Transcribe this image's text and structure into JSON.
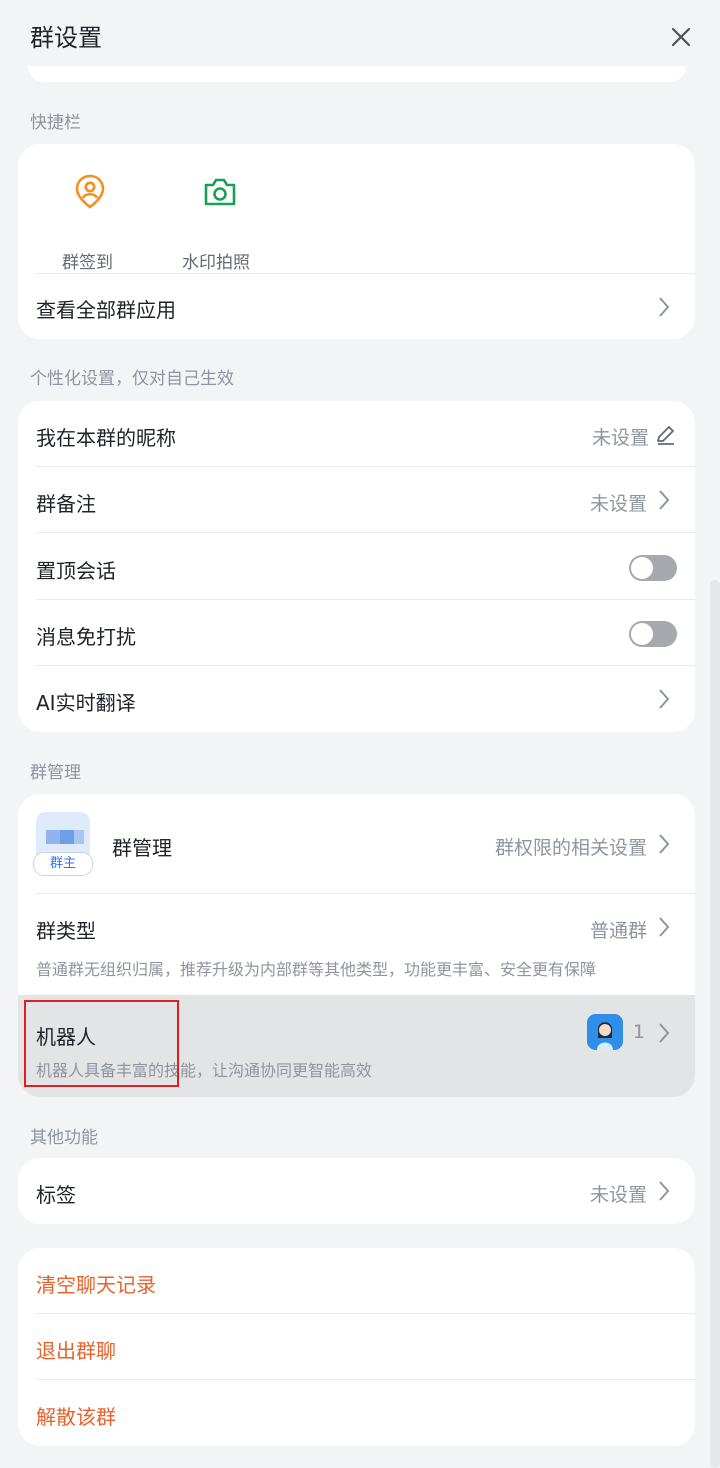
{
  "header": {
    "title": "群设置",
    "close_icon": "close-icon"
  },
  "quick_bar": {
    "section_label": "快捷栏",
    "items": [
      {
        "label": "群签到",
        "icon": "location-person-icon",
        "color": "#f5901e"
      },
      {
        "label": "水印拍照",
        "icon": "camera-icon",
        "color": "#1aa056"
      }
    ],
    "view_all_label": "查看全部群应用"
  },
  "personal": {
    "section_label": "个性化设置，仅对自己生效",
    "nickname": {
      "label": "我在本群的昵称",
      "value": "未设置"
    },
    "remark": {
      "label": "群备注",
      "value": "未设置"
    },
    "pin": {
      "label": "置顶会话",
      "on": false
    },
    "mute": {
      "label": "消息免打扰",
      "on": false
    },
    "translate": {
      "label": "AI实时翻译"
    }
  },
  "management": {
    "section_label": "群管理",
    "manage": {
      "label": "群管理",
      "badge": "群主",
      "value": "群权限的相关设置"
    },
    "group_type": {
      "label": "群类型",
      "value": "普通群",
      "description": "普通群无组织归属，推荐升级为内部群等其他类型，功能更丰富、安全更有保障"
    },
    "robot": {
      "label": "机器人",
      "count": "1",
      "description": "机器人具备丰富的技能，让沟通协同更智能高效"
    }
  },
  "other": {
    "section_label": "其他功能",
    "tags": {
      "label": "标签",
      "value": "未设置"
    }
  },
  "danger_actions": {
    "clear_history": "清空聊天记录",
    "leave_group": "退出群聊",
    "dismiss_group": "解散该群"
  },
  "colors": {
    "accent_danger": "#e8622a",
    "background": "#f3f4f6",
    "card": "#ffffff"
  }
}
